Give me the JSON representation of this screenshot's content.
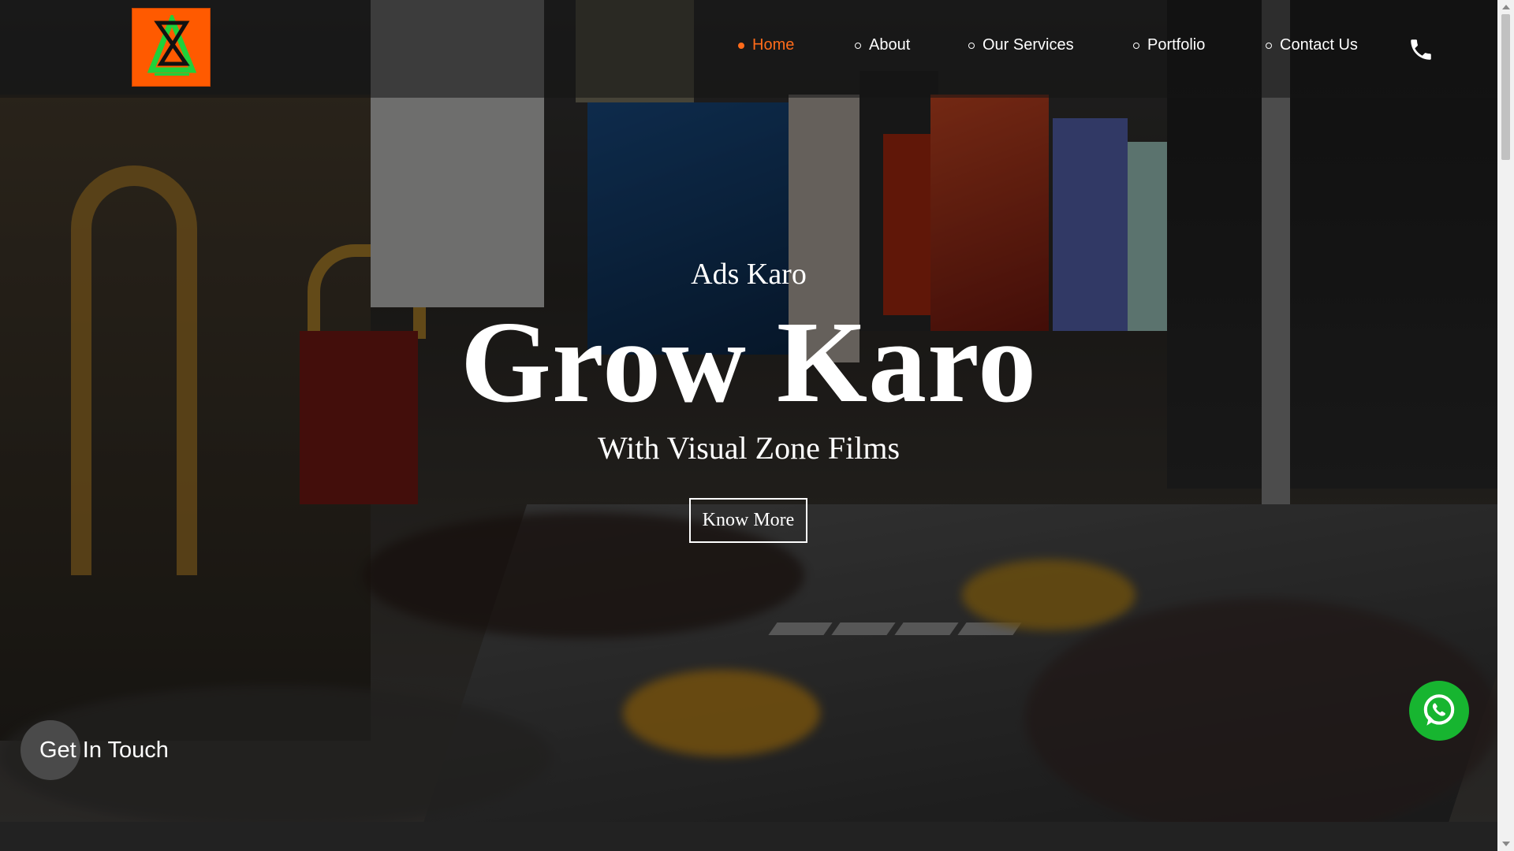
{
  "header": {
    "logo_alt": "Visual Zone Films logo",
    "nav": [
      {
        "label": "Home",
        "active": true
      },
      {
        "label": "About",
        "active": false
      },
      {
        "label": "Our Services",
        "active": false
      },
      {
        "label": "Portfolio",
        "active": false
      },
      {
        "label": "Contact Us",
        "active": false
      }
    ],
    "phone_icon": "phone-icon"
  },
  "hero": {
    "eyebrow": "Ads Karo",
    "headline": "Grow Karo",
    "subline": "With Visual Zone Films",
    "cta_label": "Know More"
  },
  "widgets": {
    "get_in_touch_label": "Get In Touch",
    "whatsapp_icon": "whatsapp-icon"
  },
  "colors": {
    "accent": "#ff6b1a",
    "logo_bg": "#ff5a00",
    "whatsapp_green": "#17b530"
  }
}
